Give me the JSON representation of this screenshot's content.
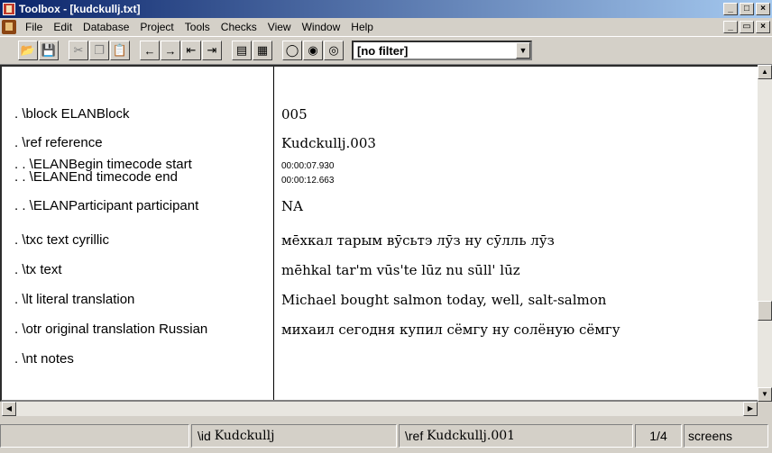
{
  "window": {
    "title": "Toolbox - [kudckullj.txt]",
    "controls": [
      "_",
      "□",
      "×"
    ],
    "doc_controls": [
      "_",
      "▭",
      "×"
    ]
  },
  "menu": [
    "File",
    "Edit",
    "Database",
    "Project",
    "Tools",
    "Checks",
    "View",
    "Window",
    "Help"
  ],
  "toolbar": {
    "filter_value": "[no filter]"
  },
  "record": {
    "fields": [
      {
        "marker": ". \\block  ELANBlock",
        "value": "005"
      },
      {
        "marker": ". \\ref  reference",
        "value": "Kudckullj.003"
      },
      {
        "marker": ". . \\ELANBegin  timecode start",
        "value": "00:00:07.930"
      },
      {
        "marker": ". . \\ELANEnd  timecode end",
        "value": "00:00:12.663"
      },
      {
        "marker": ". . \\ELANParticipant  participant",
        "value": "NA"
      },
      {
        "marker": ". \\txc  text cyrillic",
        "value": "мēхкал тарым вӯсьтэ лӯз ну сӯлль лӯз"
      },
      {
        "marker": ". \\tx  text",
        "value": "mēhkal tar'm vūs'te lūz nu sūll' lūz"
      },
      {
        "marker": ". \\lt  literal translation",
        "value": "Michael bought salmon today, well, salt-salmon"
      },
      {
        "marker": ". \\otr  original translation Russian",
        "value": "михаил сегодня купил сёмгу ну солёную сёмгу"
      },
      {
        "marker": ". \\nt  notes",
        "value": ""
      }
    ]
  },
  "status": {
    "id_label": "\\id",
    "id_value": "Kudckullj",
    "ref_label": "\\ref",
    "ref_value": "Kudckullj.001",
    "position": "1/4",
    "mode": "screens"
  }
}
